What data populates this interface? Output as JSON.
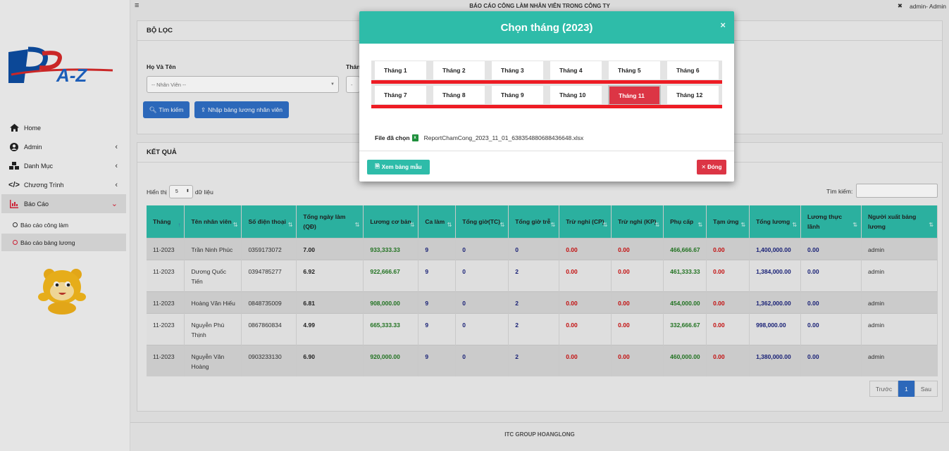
{
  "topbar": {
    "title": "BÁO CÁO CÔNG LÀM NHÂN VIÊN TRONG CÔNG TY",
    "user": "admin- Admin"
  },
  "sidebar": {
    "logo_text": "BPA-Z",
    "items": [
      {
        "label": "Home",
        "icon": "home-icon"
      },
      {
        "label": "Admin",
        "icon": "user-circle-icon"
      },
      {
        "label": "Danh Mục",
        "icon": "cubes-icon"
      },
      {
        "label": "Chương Trình",
        "icon": "code-icon"
      },
      {
        "label": "Báo Cáo",
        "icon": "chart-icon"
      }
    ],
    "subitems": [
      {
        "label": "Báo cáo công làm"
      },
      {
        "label": "Báo cáo bảng lương"
      }
    ]
  },
  "filter": {
    "title": "BỘ LỌC",
    "name_label": "Họ Và Tên",
    "name_placeholder": "-- Nhân Viên --",
    "month_label": "Thán",
    "search_button": "Tìm kiếm",
    "import_button": "Nhập bảng lương nhân viên"
  },
  "results": {
    "title": "KẾT QUẢ",
    "show_label": "Hiển thị",
    "show_value": "5",
    "entries_label": "dữ liệu",
    "search_label": "Tìm kiếm:",
    "columns": [
      "Tháng",
      "Tên nhân viên",
      "Số điện thoại",
      "Tổng ngày làm (QĐ)",
      "Lương cơ bản",
      "Ca làm",
      "Tổng giờ(TC)",
      "Tổng giờ trễ",
      "Trừ nghỉ (CP)",
      "Trừ nghỉ (KP)",
      "Phụ cấp",
      "Tạm ứng",
      "Tổng lương",
      "Lương thực lãnh",
      "Người xuất bảng lương"
    ],
    "rows": [
      [
        "11-2023",
        "Trần Ninh Phúc",
        "0359173072",
        "7.00",
        "933,333.33",
        "9",
        "0",
        "0",
        "0.00",
        "0.00",
        "466,666.67",
        "0.00",
        "1,400,000.00",
        "0.00",
        "admin"
      ],
      [
        "11-2023",
        "Dương Quốc Tiến",
        "0394785277",
        "6.92",
        "922,666.67",
        "9",
        "0",
        "2",
        "0.00",
        "0.00",
        "461,333.33",
        "0.00",
        "1,384,000.00",
        "0.00",
        "admin"
      ],
      [
        "11-2023",
        "Hoàng Văn Hiếu",
        "0848735009",
        "6.81",
        "908,000.00",
        "9",
        "0",
        "2",
        "0.00",
        "0.00",
        "454,000.00",
        "0.00",
        "1,362,000.00",
        "0.00",
        "admin"
      ],
      [
        "11-2023",
        "Nguyễn Phú Thịnh",
        "0867860834",
        "4.99",
        "665,333.33",
        "9",
        "0",
        "2",
        "0.00",
        "0.00",
        "332,666.67",
        "0.00",
        "998,000.00",
        "0.00",
        "admin"
      ],
      [
        "11-2023",
        "Nguyễn Văn Hoàng",
        "0903233130",
        "6.90",
        "920,000.00",
        "9",
        "0",
        "2",
        "0.00",
        "0.00",
        "460,000.00",
        "0.00",
        "1,380,000.00",
        "0.00",
        "admin"
      ]
    ],
    "pager": {
      "prev": "Trước",
      "current": "1",
      "next": "Sau"
    }
  },
  "footer": {
    "text": "ITC GROUP HOANGLONG"
  },
  "modal": {
    "title": "Chọn tháng (2023)",
    "close": "×",
    "months": [
      "Tháng 1",
      "Tháng 2",
      "Tháng 3",
      "Tháng 4",
      "Tháng 5",
      "Tháng 6",
      "Tháng 7",
      "Tháng 8",
      "Tháng 9",
      "Tháng 10",
      "Tháng 11",
      "Tháng 12"
    ],
    "selected_month": "Tháng 11",
    "file_label": "File đã chọn",
    "file_name": "ReportChamCong_2023_11_01_638354880688436648.xlsx",
    "template_button": "Xem bảng mẫu",
    "close_button": "Đóng"
  },
  "colors": {
    "teal": "#2ebca9",
    "red": "#dc3545",
    "blue": "#2f6fc6",
    "green": "#237a23",
    "navy": "#1a237e"
  }
}
